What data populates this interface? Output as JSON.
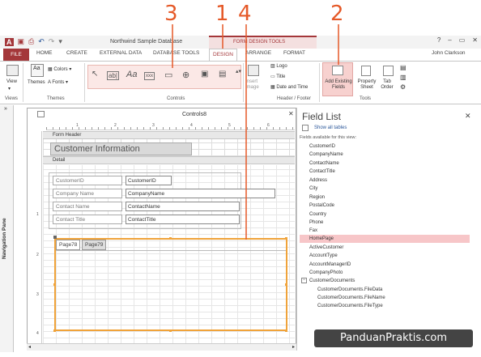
{
  "callouts": [
    "3",
    "1",
    "4",
    "2"
  ],
  "app": {
    "title": "Northwind Sample Database",
    "context_header": "FORM DESIGN TOOLS",
    "user": "John Clarkson",
    "win_controls": [
      "?",
      "–",
      "▭",
      "✕"
    ]
  },
  "tabs": {
    "file": "FILE",
    "items": [
      "HOME",
      "CREATE",
      "EXTERNAL DATA",
      "DATABASE TOOLS"
    ],
    "design": "DESIGN",
    "arrange": "ARRANGE",
    "format": "FORMAT"
  },
  "ribbon": {
    "view": "View",
    "views_group": "Views",
    "themes": "Themes",
    "colors": "Colors",
    "fonts": "Fonts",
    "themes_group": "Themes",
    "controls_group": "Controls",
    "insert_image": "Insert Image",
    "logo": "Logo",
    "title": "Title",
    "date_time": "Date and Time",
    "header_footer_group": "Header / Footer",
    "add_existing_fields": "Add Existing Fields",
    "property_sheet": "Property Sheet",
    "tab_order": "Tab Order",
    "tools_group": "Tools"
  },
  "nav_pane": {
    "label": "Navigation Pane",
    "toggle": "»"
  },
  "document": {
    "title": "Controls8",
    "ruler_top": [
      "1",
      "2",
      "3",
      "4",
      "5",
      "6"
    ],
    "ruler_left": [
      "1",
      "2",
      "3",
      "4"
    ],
    "form_header": "Form Header",
    "header_title": "Customer Information",
    "detail": "Detail",
    "fields": [
      {
        "label": "CustomerID",
        "value": "CustomerID"
      },
      {
        "label": "Company Name",
        "value": "CompanyName"
      },
      {
        "label": "Contact Name",
        "value": "ContactName"
      },
      {
        "label": "Contact Title",
        "value": "ContactTitle"
      }
    ],
    "tab_pages": [
      "Page78",
      "Page79"
    ]
  },
  "field_list": {
    "title": "Field List",
    "show_all": "Show all tables",
    "available": "Fields available for this view:",
    "fields": [
      "CustomerID",
      "CompanyName",
      "ContactName",
      "ContactTitle",
      "Address",
      "City",
      "Region",
      "PostalCode",
      "Country",
      "Phone",
      "Fax",
      "HomePage",
      "ActiveCustomer",
      "AccountType",
      "AccountManagerID",
      "CompanyPhoto",
      "CustomerDocuments"
    ],
    "selected": "HomePage",
    "sub_fields": [
      "CustomerDocuments.FileData",
      "CustomerDocuments.FileName",
      "CustomerDocuments.FileType"
    ]
  },
  "watermark": "PanduanPraktis.com"
}
